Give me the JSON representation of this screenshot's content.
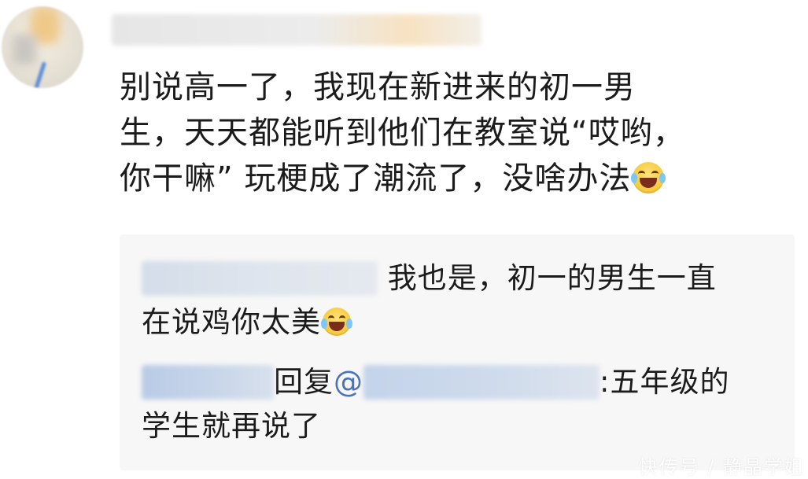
{
  "comment": {
    "lines": [
      "别说高一了，我现在新进来的初一男",
      "生，天天都能听到他们在教室说“哎哟，",
      "你干嘛” 玩梗成了潮流了，没啥办法"
    ],
    "emoji": "laughing-with-tears-icon"
  },
  "replies": [
    {
      "text_line1": "我也是，初一的男生一直",
      "text_line2": "在说鸡你太美",
      "emoji": "laughing-with-tears-icon"
    },
    {
      "verb": "回复",
      "at": "@",
      "text_line1": ":五年级的",
      "text_line2": "学生就再说了"
    }
  ],
  "watermark": "快传号 / 静晶学姐",
  "colors": {
    "background": "#ffffff",
    "reply_background": "#f7f7f7",
    "text": "#1b1b1b",
    "mention": "#4a74b9"
  }
}
